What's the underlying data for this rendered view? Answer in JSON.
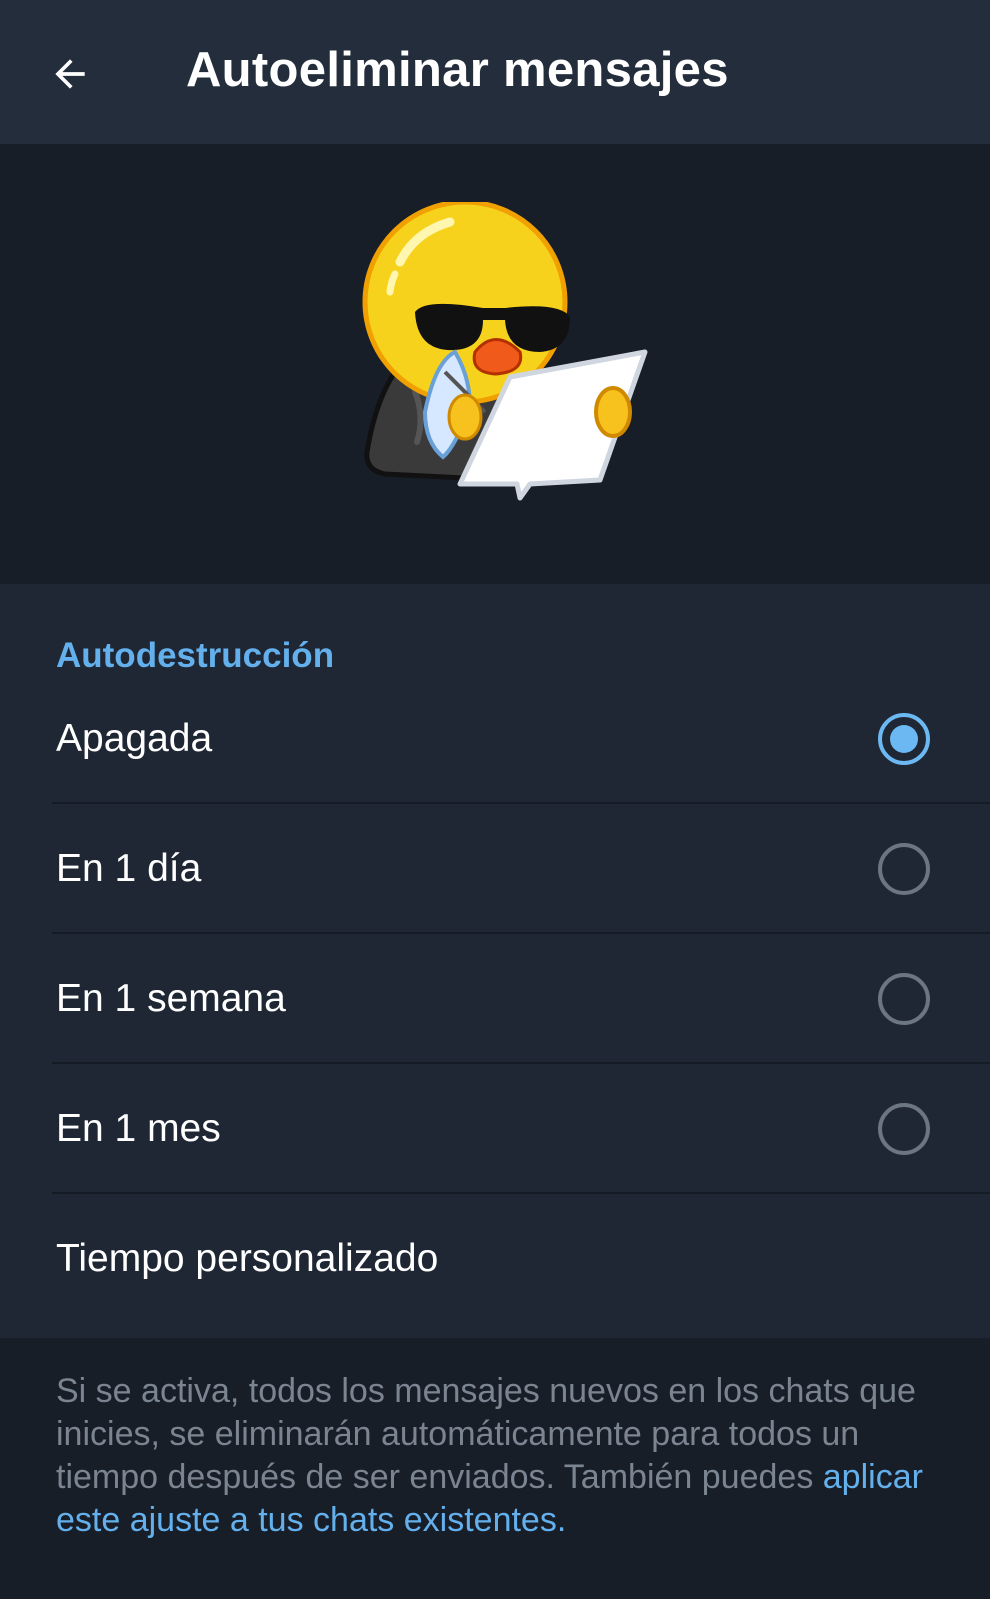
{
  "header": {
    "back_icon": "arrow-left-icon",
    "title": "Autoeliminar mensajes"
  },
  "sticker": {
    "icon": "duck-with-sunglasses-writing-sticker"
  },
  "section": {
    "title": "Autodestrucción",
    "options": [
      {
        "label": "Apagada",
        "selected": true
      },
      {
        "label": "En 1 día",
        "selected": false
      },
      {
        "label": "En 1 semana",
        "selected": false
      },
      {
        "label": "En 1 mes",
        "selected": false
      },
      {
        "label": "Tiempo personalizado"
      }
    ]
  },
  "note": {
    "text": "Si se activa, todos los mensajes nuevos en los chats que inicies, se eliminarán automáticamente para todos un tiempo después de ser enviados. También puedes ",
    "link": "aplicar este ajuste a tus chats existentes."
  },
  "colors": {
    "header_bg": "#242d3c",
    "page_bg": "#181e28",
    "section_bg": "#1f2735",
    "accent": "#63b0ec",
    "radio_off": "#6c7683",
    "note_text": "#7b8591"
  }
}
